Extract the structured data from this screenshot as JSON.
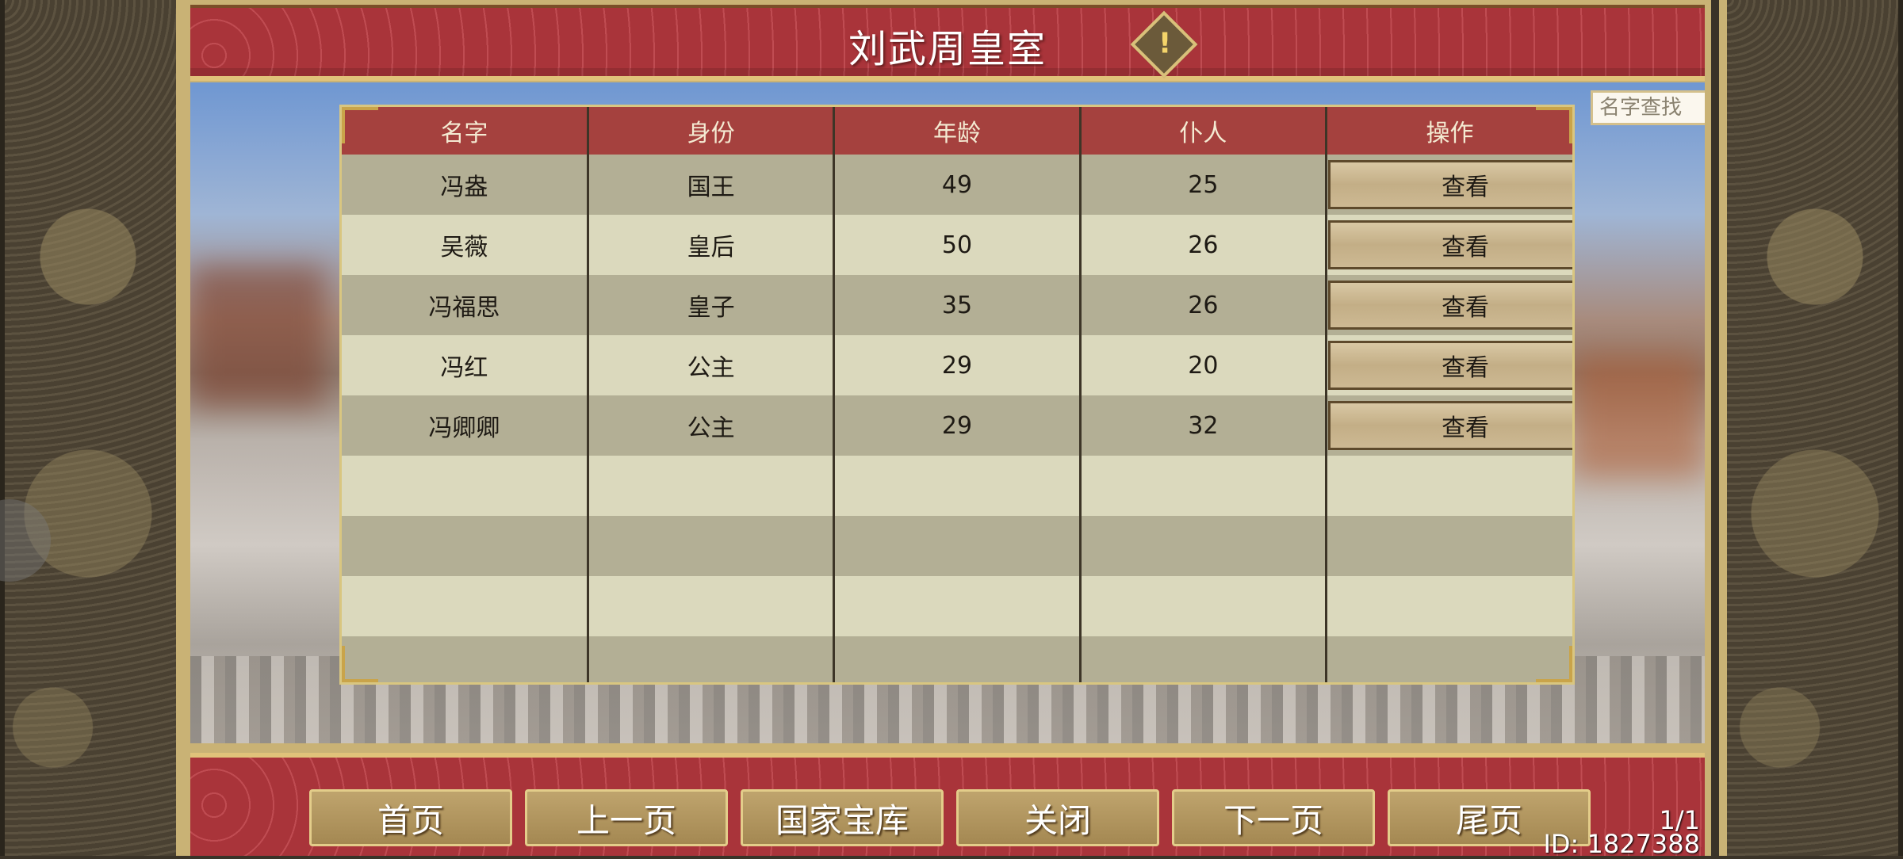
{
  "title": "刘武周皇室",
  "search": {
    "placeholder": "名字查找"
  },
  "table": {
    "headers": [
      "名字",
      "身份",
      "年龄",
      "仆人",
      "操作"
    ],
    "rows": [
      {
        "name": "冯盎",
        "role": "国王",
        "age": "49",
        "servants": "25",
        "action": "查看"
      },
      {
        "name": "吴薇",
        "role": "皇后",
        "age": "50",
        "servants": "26",
        "action": "查看"
      },
      {
        "name": "冯福思",
        "role": "皇子",
        "age": "35",
        "servants": "26",
        "action": "查看"
      },
      {
        "name": "冯红",
        "role": "公主",
        "age": "29",
        "servants": "20",
        "action": "查看"
      },
      {
        "name": "冯卿卿",
        "role": "公主",
        "age": "29",
        "servants": "32",
        "action": "查看"
      }
    ]
  },
  "footer": {
    "buttons": [
      "首页",
      "上一页",
      "国家宝库",
      "关闭",
      "下一页",
      "尾页"
    ],
    "page": "1/1",
    "id": "ID: 1827388"
  },
  "icons": {
    "alert": "exclamation-icon"
  },
  "colors": {
    "header_red": "#a5413e",
    "gold": "#c9b275",
    "row_dark": "#b3af95",
    "row_light": "#dbd9bd"
  }
}
